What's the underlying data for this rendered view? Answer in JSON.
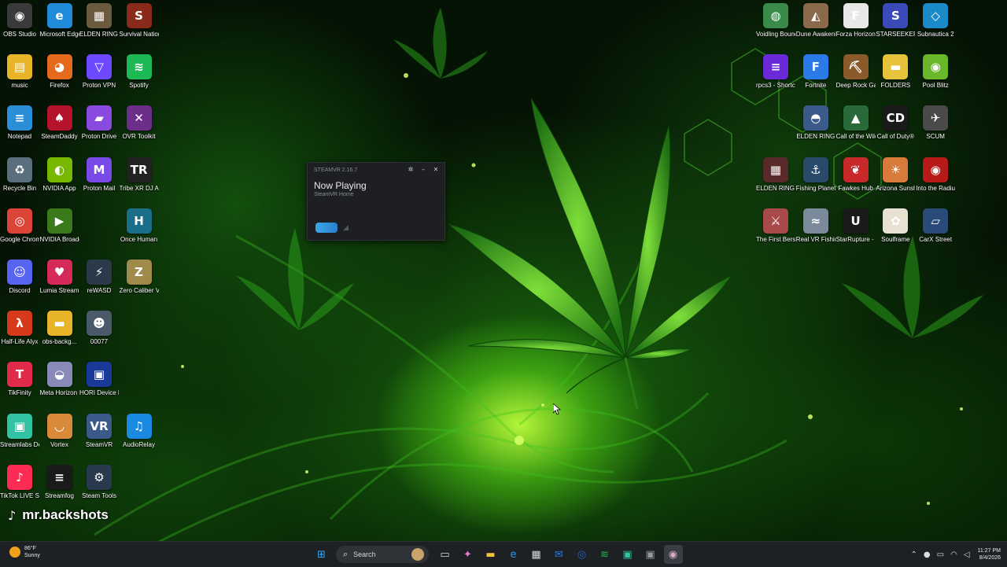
{
  "desktop": {
    "left_icons": [
      {
        "label": "OBS Studio",
        "icon": "obs-icon",
        "color": "#3a3a3a",
        "glyph": "◉"
      },
      {
        "label": "Microsoft Edge",
        "icon": "edge-icon",
        "color": "#1f8bd9",
        "glyph": "e"
      },
      {
        "label": "ELDEN RING - ArtBook ...",
        "icon": "elden-ring-artbook-icon",
        "color": "#6b5a3e",
        "glyph": "▦"
      },
      {
        "label": "Survival Nation",
        "icon": "survival-nation-icon",
        "color": "#8a2a1a",
        "glyph": "S"
      },
      {
        "label": "music",
        "icon": "music-folder-icon",
        "color": "#e8b52a",
        "glyph": "▤"
      },
      {
        "label": "Firefox",
        "icon": "firefox-icon",
        "color": "#e66a1c",
        "glyph": "◕"
      },
      {
        "label": "Proton VPN",
        "icon": "proton-vpn-icon",
        "color": "#6d4aff",
        "glyph": "▽"
      },
      {
        "label": "Spotify",
        "icon": "spotify-icon",
        "color": "#1db954",
        "glyph": "≋"
      },
      {
        "label": "Notepad",
        "icon": "notepad-icon",
        "color": "#2a8fd6",
        "glyph": "≡"
      },
      {
        "label": "SteamDaddy",
        "icon": "steamdaddy-icon",
        "color": "#b5122c",
        "glyph": "♠"
      },
      {
        "label": "Proton Drive",
        "icon": "proton-drive-icon",
        "color": "#8a4ae0",
        "glyph": "▰"
      },
      {
        "label": "OVR Toolkit",
        "icon": "ovr-toolkit-icon",
        "color": "#6b2f8a",
        "glyph": "✕"
      },
      {
        "label": "Recycle Bin",
        "icon": "recycle-bin-icon",
        "color": "#5a6e7e",
        "glyph": "♻"
      },
      {
        "label": "NVIDIA App",
        "icon": "nvidia-app-icon",
        "color": "#76b900",
        "glyph": "◐"
      },
      {
        "label": "Proton Mail",
        "icon": "proton-mail-icon",
        "color": "#7a4ae8",
        "glyph": "M"
      },
      {
        "label": "Tribe XR DJ Academy",
        "icon": "tribe-xr-icon",
        "color": "#222222",
        "glyph": "TR"
      },
      {
        "label": "Google Chrome",
        "icon": "chrome-icon",
        "color": "#db4437",
        "glyph": "◎"
      },
      {
        "label": "NVIDIA Broadcast",
        "icon": "nvidia-broadcast-icon",
        "color": "#3a7a1a",
        "glyph": "▶"
      },
      {
        "label": "",
        "icon": "blank-slot-icon",
        "color": "transparent",
        "glyph": ""
      },
      {
        "label": "Once Human",
        "icon": "once-human-icon",
        "color": "#1a6e8a",
        "glyph": "H"
      },
      {
        "label": "Discord",
        "icon": "discord-icon",
        "color": "#5865f2",
        "glyph": "☺"
      },
      {
        "label": "Lumia Stream",
        "icon": "lumia-stream-icon",
        "color": "#d62a5a",
        "glyph": "♥"
      },
      {
        "label": "reWASD",
        "icon": "rewasd-icon",
        "color": "#2a3a4a",
        "glyph": "⚡"
      },
      {
        "label": "Zero Caliber VR",
        "icon": "zero-caliber-icon",
        "color": "#a08a4a",
        "glyph": "Z"
      },
      {
        "label": "Half-Life Alyx",
        "icon": "half-life-alyx-icon",
        "color": "#d63a1a",
        "glyph": "λ"
      },
      {
        "label": "obs-backg...",
        "icon": "obs-background-folder-icon",
        "color": "#e8b52a",
        "glyph": "▬"
      },
      {
        "label": "00077",
        "icon": "image-file-icon",
        "color": "#4a5a6a",
        "glyph": "☻"
      },
      {
        "label": "",
        "icon": "blank-slot-icon",
        "color": "transparent",
        "glyph": ""
      },
      {
        "label": "TikFinity",
        "icon": "tikfinity-icon",
        "color": "#e22a4a",
        "glyph": "T"
      },
      {
        "label": "Meta Horizon Link",
        "icon": "meta-horizon-link-icon",
        "color": "#8a8ab8",
        "glyph": "◒"
      },
      {
        "label": "HORI Device Manager",
        "icon": "hori-device-icon",
        "color": "#1a3a9a",
        "glyph": "▣"
      },
      {
        "label": "",
        "icon": "blank-slot-icon",
        "color": "transparent",
        "glyph": ""
      },
      {
        "label": "Streamlabs Desktop",
        "icon": "streamlabs-icon",
        "color": "#31c3a2",
        "glyph": "▣"
      },
      {
        "label": "Vortex",
        "icon": "vortex-icon",
        "color": "#d88a3a",
        "glyph": "◡"
      },
      {
        "label": "SteamVR",
        "icon": "steamvr-icon",
        "color": "#3a5a8a",
        "glyph": "VR"
      },
      {
        "label": "AudioRelay",
        "icon": "audiorelay-icon",
        "color": "#1a8ae0",
        "glyph": "♫"
      },
      {
        "label": "TikTok LIVE Studio",
        "icon": "tiktok-live-icon",
        "color": "#fe2c55",
        "glyph": "♪"
      },
      {
        "label": "Streamfog",
        "icon": "streamfog-icon",
        "color": "#1a1a1a",
        "glyph": "≡"
      },
      {
        "label": "Steam Tools",
        "icon": "steam-tools-icon",
        "color": "#2a3a4e",
        "glyph": "⚙"
      }
    ],
    "right_icons": [
      {
        "label": "Voidling Bound",
        "icon": "voidling-bound-icon",
        "color": "#3a8a4a",
        "glyph": "◍"
      },
      {
        "label": "Dune Awakening",
        "icon": "dune-awakening-icon",
        "color": "#8a6a4a",
        "glyph": "◭"
      },
      {
        "label": "Forza Horizon 6",
        "icon": "forza-horizon-icon",
        "color": "#e8e8e8",
        "glyph": "F"
      },
      {
        "label": "STARSEEKER Astroneer...",
        "icon": "starseeker-icon",
        "color": "#3a4ab8",
        "glyph": "S"
      },
      {
        "label": "Subnautica 2",
        "icon": "subnautica-icon",
        "color": "#1a8ac8",
        "glyph": "◇"
      },
      {
        "label": "rpcs3 - Shortcut",
        "icon": "rpcs3-icon",
        "color": "#6a2ad8",
        "glyph": "≡"
      },
      {
        "label": "Fortnite",
        "icon": "fortnite-icon",
        "color": "#2a7ae8",
        "glyph": "F"
      },
      {
        "label": "Deep Rock Galactic",
        "icon": "deep-rock-galactic-icon",
        "color": "#8a5a2a",
        "glyph": "⛏"
      },
      {
        "label": "FOLDERS",
        "icon": "folders-icon",
        "color": "#e8c23a",
        "glyph": "▬"
      },
      {
        "label": "Pool Blitz",
        "icon": "pool-blitz-icon",
        "color": "#6ab82a",
        "glyph": "◉"
      },
      {
        "label": "",
        "icon": "blank-slot-icon",
        "color": "transparent",
        "glyph": ""
      },
      {
        "label": "ELDEN RING",
        "icon": "elden-ring-icon",
        "color": "#3a5a8a",
        "glyph": "◓"
      },
      {
        "label": "Call of the Wild Th...",
        "icon": "call-of-the-wild-icon",
        "color": "#2a6a3a",
        "glyph": "▲"
      },
      {
        "label": "Call of Duty®",
        "icon": "call-of-duty-icon",
        "color": "#1a1a1a",
        "glyph": "CD"
      },
      {
        "label": "SCUM",
        "icon": "scum-icon",
        "color": "#4a4a4a",
        "glyph": "✈"
      },
      {
        "label": "ELDEN RING - Adventu...",
        "icon": "elden-ring-adventure-icon",
        "color": "#5a2a2a",
        "glyph": "▦"
      },
      {
        "label": "Fishing Planet",
        "icon": "fishing-planet-icon",
        "color": "#2a4a6a",
        "glyph": "⚓"
      },
      {
        "label": "Fawkes Hub",
        "icon": "fawkes-hub-icon",
        "color": "#c82a2a",
        "glyph": "❦"
      },
      {
        "label": "Arizona Sunshine...",
        "icon": "arizona-sunshine-icon",
        "color": "#d87a3a",
        "glyph": "☀"
      },
      {
        "label": "Into the Radius VR",
        "icon": "into-the-radius-icon",
        "color": "#b81a1a",
        "glyph": "◉"
      },
      {
        "label": "The First Berserke...",
        "icon": "first-berserker-icon",
        "color": "#a84a4a",
        "glyph": "⚔"
      },
      {
        "label": "Real VR Fishing",
        "icon": "real-vr-fishing-icon",
        "color": "#7a8a9a",
        "glyph": "≈"
      },
      {
        "label": "StarRupture - Shortcut",
        "icon": "starrupture-icon",
        "color": "#1a1a1a",
        "glyph": "U"
      },
      {
        "label": "Soulframe",
        "icon": "soulframe-icon",
        "color": "#e8e0d0",
        "glyph": "✿"
      },
      {
        "label": "CarX Street",
        "icon": "carx-street-icon",
        "color": "#2a4a7a",
        "glyph": "▱"
      }
    ]
  },
  "steamvr_window": {
    "title": "STEAMVR 2.16.7",
    "heading": "Now Playing",
    "subheading": "SteamVR Home",
    "headset_color": "#3aa8e8"
  },
  "watermark": {
    "name": "mr.backshots"
  },
  "taskbar": {
    "weather_temp": "86°F",
    "weather_text": "Sunny",
    "search_label": "Search",
    "pinned": [
      {
        "icon": "start-windows-icon",
        "glyph": "⊞",
        "color": "#3aa8f0"
      },
      {
        "icon": "task-view-icon",
        "glyph": "▭",
        "color": "#d8d8d8"
      },
      {
        "icon": "copilot-icon",
        "glyph": "✦",
        "color": "#e87ad8"
      },
      {
        "icon": "file-explorer-icon",
        "glyph": "▬",
        "color": "#f0c23a"
      },
      {
        "icon": "edge-taskbar-icon",
        "glyph": "e",
        "color": "#2a9ae8"
      },
      {
        "icon": "microsoft-store-icon",
        "glyph": "▦",
        "color": "#d8d8d8"
      },
      {
        "icon": "outlook-icon",
        "glyph": "✉",
        "color": "#2a7ad8"
      },
      {
        "icon": "chrome-taskbar-icon",
        "glyph": "◎",
        "color": "#1a6ad8"
      },
      {
        "icon": "spotify-taskbar-icon",
        "glyph": "≋",
        "color": "#1db954"
      },
      {
        "icon": "streamlabs-taskbar-icon",
        "glyph": "▣",
        "color": "#31c3a2"
      },
      {
        "icon": "terminal-icon",
        "glyph": "▣",
        "color": "#9a9a9a"
      },
      {
        "icon": "obs-taskbar-icon",
        "glyph": "◉",
        "color": "#d8a8c8"
      }
    ],
    "time": "11:27 PM",
    "date": "8/4/2026"
  }
}
